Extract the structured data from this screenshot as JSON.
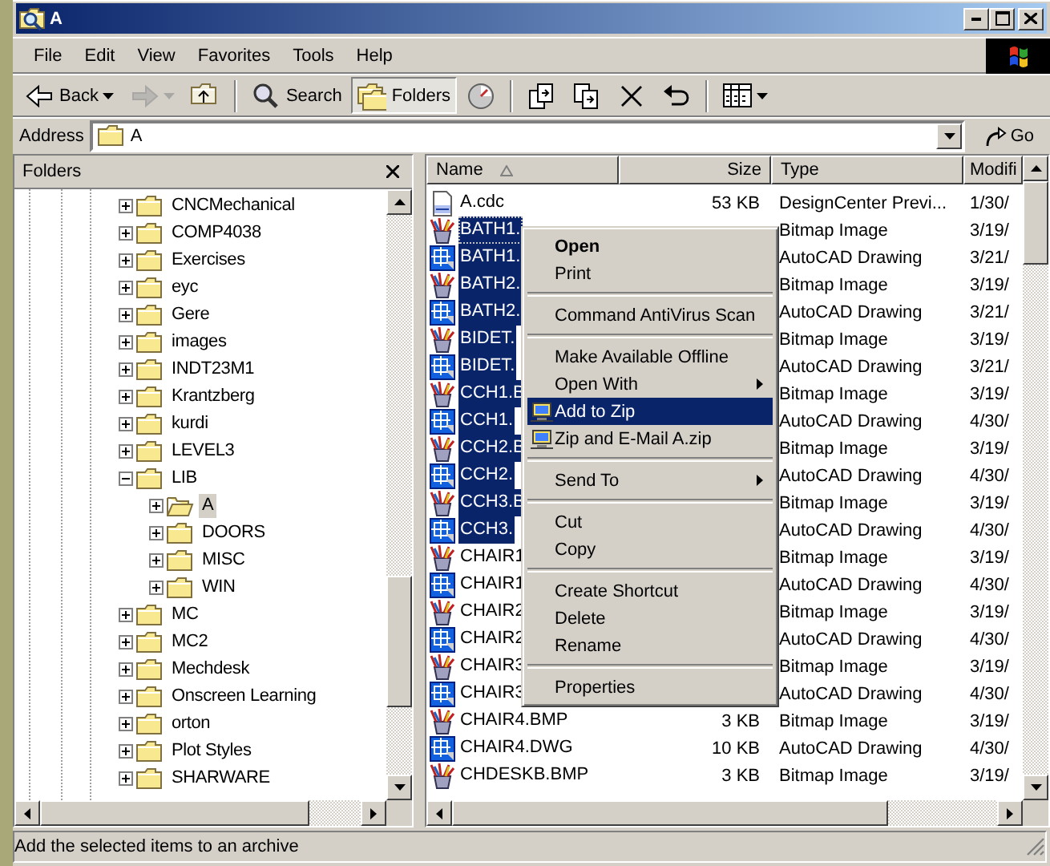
{
  "window": {
    "title": "A"
  },
  "menu_bar": [
    "File",
    "Edit",
    "View",
    "Favorites",
    "Tools",
    "Help"
  ],
  "toolbar": [
    {
      "kind": "back",
      "label": "Back",
      "dropdown": true,
      "disabled": false,
      "pressed": false
    },
    {
      "kind": "forward",
      "dropdown": true,
      "disabled": true,
      "pressed": false
    },
    {
      "kind": "up",
      "dropdown": false,
      "disabled": false,
      "pressed": false
    },
    {
      "kind": "separator"
    },
    {
      "kind": "search",
      "label": "Search",
      "dropdown": false,
      "disabled": false,
      "pressed": false
    },
    {
      "kind": "folders",
      "label": "Folders",
      "dropdown": false,
      "disabled": false,
      "pressed": true
    },
    {
      "kind": "history",
      "dropdown": false,
      "disabled": false,
      "pressed": false
    },
    {
      "kind": "separator"
    },
    {
      "kind": "move-to",
      "dropdown": false,
      "disabled": false,
      "pressed": false
    },
    {
      "kind": "copy-to",
      "dropdown": false,
      "disabled": false,
      "pressed": false
    },
    {
      "kind": "delete",
      "dropdown": false,
      "disabled": false,
      "pressed": false
    },
    {
      "kind": "undo",
      "dropdown": false,
      "disabled": false,
      "pressed": false
    },
    {
      "kind": "separator"
    },
    {
      "kind": "views",
      "dropdown": true,
      "disabled": false,
      "pressed": false
    }
  ],
  "address": {
    "label": "Address",
    "value": "A",
    "go": "Go"
  },
  "folders_pane": {
    "title": "Folders",
    "tree": [
      {
        "name": "CNCMechanical",
        "expanded": false,
        "selected": false
      },
      {
        "name": "COMP4038",
        "expanded": false,
        "selected": false
      },
      {
        "name": "Exercises",
        "expanded": false,
        "selected": false
      },
      {
        "name": "eyc",
        "expanded": false,
        "selected": false
      },
      {
        "name": "Gere",
        "expanded": false,
        "selected": false
      },
      {
        "name": "images",
        "expanded": false,
        "selected": false
      },
      {
        "name": "INDT23M1",
        "expanded": false,
        "selected": false
      },
      {
        "name": "Krantzberg",
        "expanded": false,
        "selected": false
      },
      {
        "name": "kurdi",
        "expanded": false,
        "selected": false
      },
      {
        "name": "LEVEL3",
        "expanded": false,
        "selected": false
      },
      {
        "name": "LIB",
        "expanded": true,
        "selected": false,
        "children": [
          {
            "name": "A",
            "expanded": false,
            "selected": true
          },
          {
            "name": "DOORS",
            "expanded": false,
            "selected": false
          },
          {
            "name": "MISC",
            "expanded": false,
            "selected": false
          },
          {
            "name": "WIN",
            "expanded": false,
            "selected": false
          }
        ]
      },
      {
        "name": "MC",
        "expanded": false,
        "selected": false
      },
      {
        "name": "MC2",
        "expanded": false,
        "selected": false
      },
      {
        "name": "Mechdesk",
        "expanded": false,
        "selected": false
      },
      {
        "name": "Onscreen Learning",
        "expanded": false,
        "selected": false
      },
      {
        "name": "orton",
        "expanded": false,
        "selected": false
      },
      {
        "name": "Plot Styles",
        "expanded": false,
        "selected": false
      },
      {
        "name": "SHARWARE",
        "expanded": false,
        "selected": false
      }
    ]
  },
  "file_list": {
    "columns": [
      {
        "label": "Name",
        "sorted": true
      },
      {
        "label": "Size",
        "sorted": false
      },
      {
        "label": "Type",
        "sorted": false
      },
      {
        "label": "Modifi",
        "sorted": false
      }
    ],
    "rows": [
      {
        "kind": "cdc",
        "name": "A.cdc",
        "size": "53 KB",
        "type": "DesignCenter Previ...",
        "modified": "1/30/",
        "selected": false,
        "focused": false
      },
      {
        "kind": "bitmap",
        "name": "BATH1.",
        "type": "Bitmap Image",
        "modified": "3/19/",
        "selected": true,
        "focused": true
      },
      {
        "kind": "dwg",
        "name": "BATH1.",
        "type": "AutoCAD Drawing",
        "modified": "3/21/",
        "selected": true,
        "focused": false
      },
      {
        "kind": "bitmap",
        "name": "BATH2.",
        "type": "Bitmap Image",
        "modified": "3/19/",
        "selected": true,
        "focused": false
      },
      {
        "kind": "dwg",
        "name": "BATH2.",
        "type": "AutoCAD Drawing",
        "modified": "3/21/",
        "selected": true,
        "focused": false
      },
      {
        "kind": "bitmap",
        "name": "BIDET.",
        "type": "Bitmap Image",
        "modified": "3/19/",
        "selected": true,
        "focused": false
      },
      {
        "kind": "dwg",
        "name": "BIDET.",
        "type": "AutoCAD Drawing",
        "modified": "3/21/",
        "selected": true,
        "focused": false
      },
      {
        "kind": "bitmap",
        "name": "CCH1.B",
        "type": "Bitmap Image",
        "modified": "3/19/",
        "selected": true,
        "focused": false
      },
      {
        "kind": "dwg",
        "name": "CCH1.",
        "type": "AutoCAD Drawing",
        "modified": "4/30/",
        "selected": true,
        "focused": false
      },
      {
        "kind": "bitmap",
        "name": "CCH2.B",
        "type": "Bitmap Image",
        "modified": "3/19/",
        "selected": true,
        "focused": false
      },
      {
        "kind": "dwg",
        "name": "CCH2.",
        "type": "AutoCAD Drawing",
        "modified": "4/30/",
        "selected": true,
        "focused": false
      },
      {
        "kind": "bitmap",
        "name": "CCH3.B",
        "type": "Bitmap Image",
        "modified": "3/19/",
        "selected": true,
        "focused": false
      },
      {
        "kind": "dwg",
        "name": "CCH3.",
        "type": "AutoCAD Drawing",
        "modified": "4/30/",
        "selected": true,
        "focused": false
      },
      {
        "kind": "bitmap",
        "name": "CHAIR1",
        "type": "Bitmap Image",
        "modified": "3/19/",
        "selected": false,
        "focused": false
      },
      {
        "kind": "dwg",
        "name": "CHAIR1",
        "type": "AutoCAD Drawing",
        "modified": "4/30/",
        "selected": false,
        "focused": false
      },
      {
        "kind": "bitmap",
        "name": "CHAIR2",
        "type": "Bitmap Image",
        "modified": "3/19/",
        "selected": false,
        "focused": false
      },
      {
        "kind": "dwg",
        "name": "CHAIR2",
        "type": "AutoCAD Drawing",
        "modified": "4/30/",
        "selected": false,
        "focused": false
      },
      {
        "kind": "bitmap",
        "name": "CHAIR3",
        "type": "Bitmap Image",
        "modified": "3/19/",
        "selected": false,
        "focused": false
      },
      {
        "kind": "dwg",
        "name": "CHAIR3",
        "type": "AutoCAD Drawing",
        "modified": "4/30/",
        "selected": false,
        "focused": false
      },
      {
        "kind": "bitmap",
        "name": "CHAIR4.BMP",
        "size": "3 KB",
        "type": "Bitmap Image",
        "modified": "3/19/",
        "selected": false,
        "focused": false
      },
      {
        "kind": "dwg",
        "name": "CHAIR4.DWG",
        "size": "10 KB",
        "type": "AutoCAD Drawing",
        "modified": "4/30/",
        "selected": false,
        "focused": false
      },
      {
        "kind": "bitmap",
        "name": "CHDESKB.BMP",
        "size": "3 KB",
        "type": "Bitmap Image",
        "modified": "3/19/",
        "selected": false,
        "focused": false
      }
    ]
  },
  "context_menu": [
    {
      "kind": "item",
      "label": "Open",
      "default": true,
      "highlighted": false,
      "submenu": false,
      "icon": false
    },
    {
      "kind": "item",
      "label": "Print",
      "default": false,
      "highlighted": false,
      "submenu": false,
      "icon": false
    },
    {
      "kind": "separator"
    },
    {
      "kind": "item",
      "label": "Command AntiVirus Scan",
      "default": false,
      "highlighted": false,
      "submenu": false,
      "icon": false
    },
    {
      "kind": "separator"
    },
    {
      "kind": "item",
      "label": "Make Available Offline",
      "default": false,
      "highlighted": false,
      "submenu": false,
      "icon": false
    },
    {
      "kind": "item",
      "label": "Open With",
      "default": false,
      "highlighted": false,
      "submenu": true,
      "icon": false
    },
    {
      "kind": "item",
      "label": "Add to Zip",
      "default": false,
      "highlighted": true,
      "submenu": false,
      "icon": true
    },
    {
      "kind": "item",
      "label": "Zip and E-Mail A.zip",
      "default": false,
      "highlighted": false,
      "submenu": false,
      "icon": true
    },
    {
      "kind": "separator"
    },
    {
      "kind": "item",
      "label": "Send To",
      "default": false,
      "highlighted": false,
      "submenu": true,
      "icon": false
    },
    {
      "kind": "separator"
    },
    {
      "kind": "item",
      "label": "Cut",
      "default": false,
      "highlighted": false,
      "submenu": false,
      "icon": false
    },
    {
      "kind": "item",
      "label": "Copy",
      "default": false,
      "highlighted": false,
      "submenu": false,
      "icon": false
    },
    {
      "kind": "separator"
    },
    {
      "kind": "item",
      "label": "Create Shortcut",
      "default": false,
      "highlighted": false,
      "submenu": false,
      "icon": false
    },
    {
      "kind": "item",
      "label": "Delete",
      "default": false,
      "highlighted": false,
      "submenu": false,
      "icon": false
    },
    {
      "kind": "item",
      "label": "Rename",
      "default": false,
      "highlighted": false,
      "submenu": false,
      "icon": false
    },
    {
      "kind": "separator"
    },
    {
      "kind": "item",
      "label": "Properties",
      "default": false,
      "highlighted": false,
      "submenu": false,
      "icon": false
    }
  ],
  "status_bar": {
    "text": "Add the selected items to an archive"
  }
}
